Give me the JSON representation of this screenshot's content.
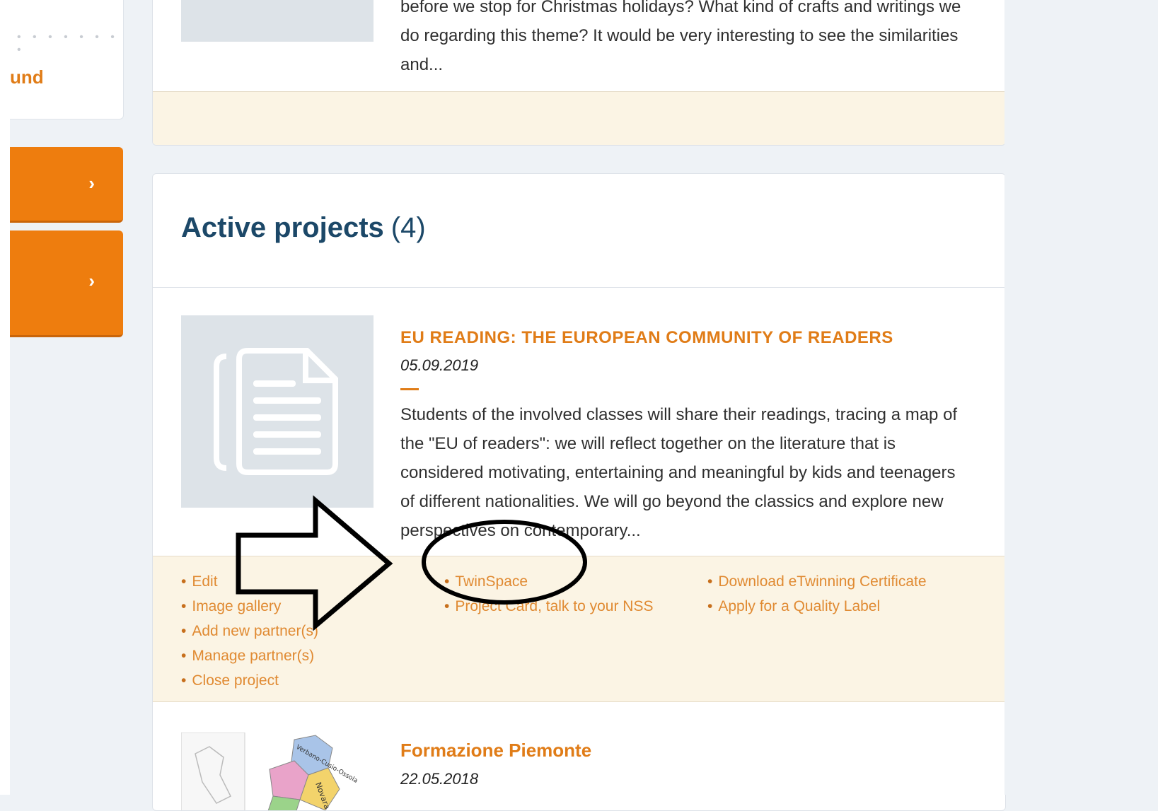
{
  "sidebar": {
    "dots": "• • • • • • • •",
    "link_partial": "und",
    "buttons": [
      {
        "icon": "chevron-right-icon",
        "glyph": "›"
      },
      {
        "icon": "chevron-right-icon",
        "glyph": "›"
      }
    ]
  },
  "previous_project": {
    "excerpt": "before we stop for Christmas holidays? What kind of crafts and writings we do regarding this theme? It would be very interesting to see the similarities and..."
  },
  "active_projects": {
    "title": "Active projects",
    "count": "(4)",
    "projects": [
      {
        "title": "EU READING: THE EUROPEAN COMMUNITY OF READERS",
        "date": "05.09.2019",
        "description": "Students of the involved classes will share their readings, tracing a map of the \"EU of readers\": we will reflect together on the literature that is considered motivating, entertaining and meaningful by kids and teenagers of different nationalities. We will go beyond the classics and explore new perspectives on contemporary...",
        "thumbnail_icon": "document-icon",
        "actions_col1": [
          "Edit",
          "Image gallery",
          "Add new partner(s)",
          "Manage partner(s)",
          "Close project"
        ],
        "actions_col2": [
          "TwinSpace",
          "Project Card, talk to your NSS"
        ],
        "actions_col3": [
          "Download eTwinning Certificate",
          "Apply for a Quality Label"
        ]
      },
      {
        "title": "Formazione Piemonte",
        "date": "22.05.2018",
        "thumbnail_icon": "map-icon",
        "map_labels": [
          "Verbano-Cusio-Ossola",
          "Novara"
        ]
      }
    ]
  },
  "annotation": {
    "arrow": "right-arrow-annotation",
    "circle": "highlight-circle-annotation"
  },
  "colors": {
    "accent": "#e07c17",
    "heading": "#1c4868",
    "button": "#ee7d0e",
    "footer_bg": "#fbf4e4"
  }
}
